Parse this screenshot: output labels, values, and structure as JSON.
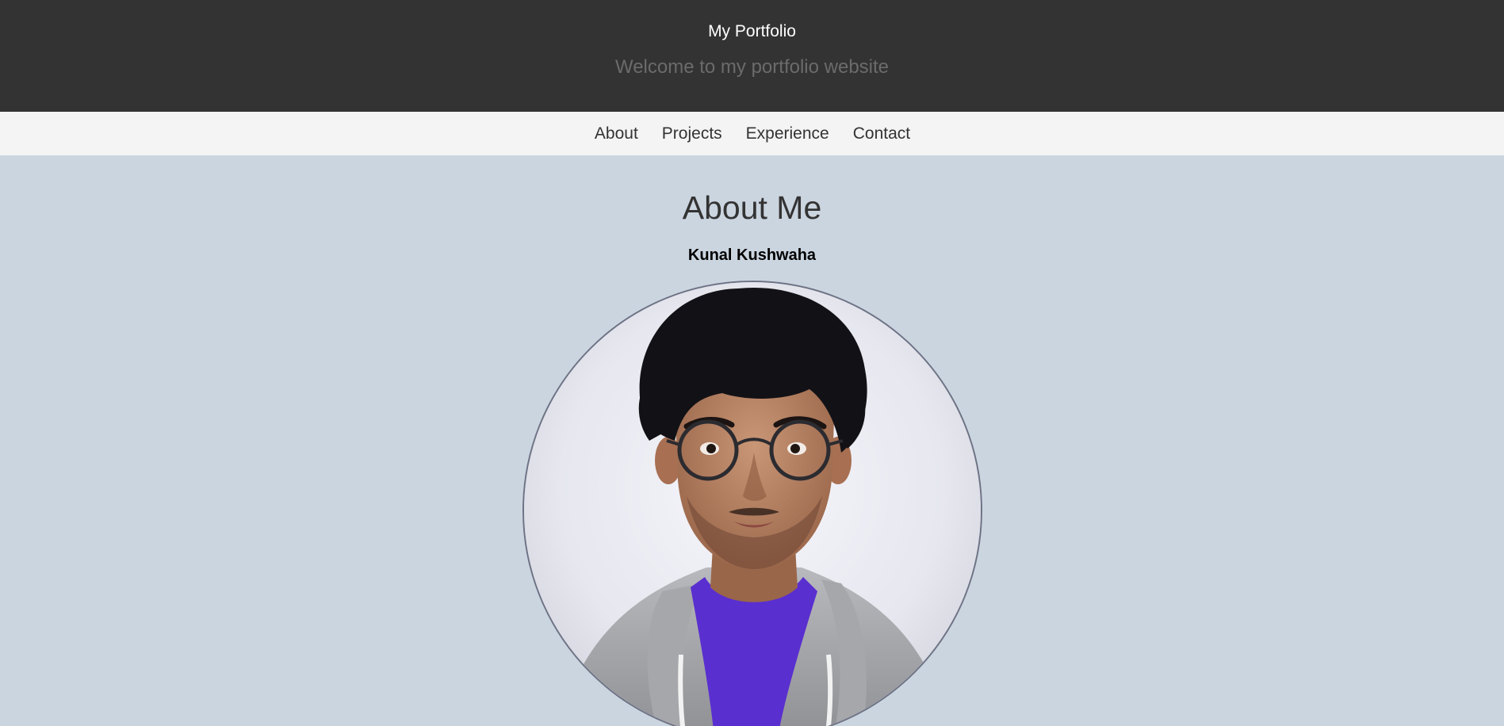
{
  "header": {
    "title": "My Portfolio",
    "tagline": "Welcome to my portfolio website"
  },
  "nav": {
    "items": [
      {
        "label": "About"
      },
      {
        "label": "Projects"
      },
      {
        "label": "Experience"
      },
      {
        "label": "Contact"
      }
    ]
  },
  "about": {
    "heading": "About Me",
    "name": "Kunal Kushwaha",
    "photo_icon": "profile-photo"
  },
  "colors": {
    "header_bg": "#333333",
    "nav_bg": "#f4f4f4",
    "page_bg": "#cbd5e0",
    "photo_border": "#6e7385"
  }
}
